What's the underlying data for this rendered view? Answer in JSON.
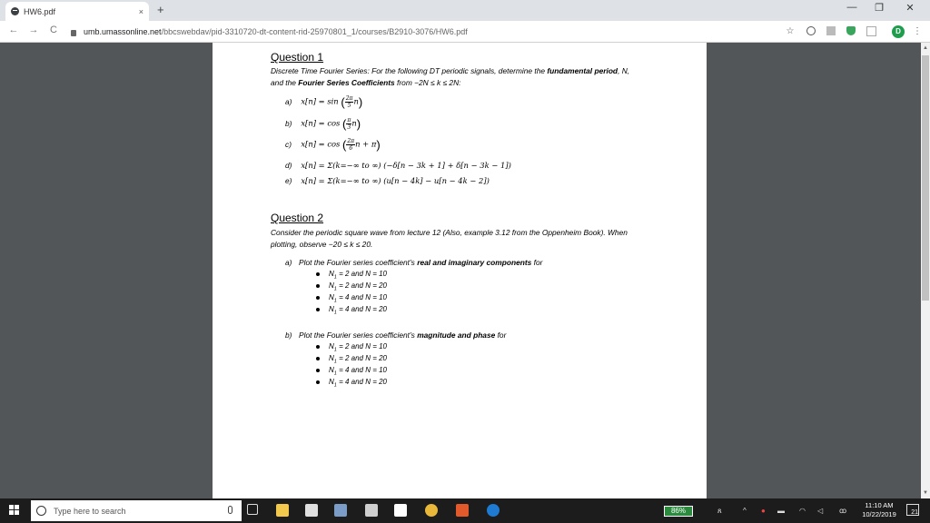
{
  "browser": {
    "tab_title": "HW6.pdf",
    "tab_close": "×",
    "new_tab": "+",
    "url_host": "umb.umassonline.net",
    "url_path": "/bbcswebdav/pid-3310720-dt-content-rid-25970801_1/courses/B2910-3076/HW6.pdf",
    "profile_initial": "D",
    "minimize": "—",
    "maximize": "❐",
    "close": "✕",
    "back": "←",
    "forward": "→",
    "reload": "C",
    "star": "☆"
  },
  "document": {
    "q1": {
      "title": "Question 1",
      "intro_a": "Discrete Time Fourier Series: For the following DT periodic signals, determine the ",
      "intro_bold1": "fundamental period",
      "intro_b": ", N,",
      "intro_c": "and the ",
      "intro_bold2": "Fourier Series Coefficients",
      "intro_d": " from −2N ≤ k ≤ 2N:",
      "items": [
        {
          "label": "a)",
          "pre": "x[n] = sin ",
          "num": "2π",
          "den": "5",
          "post": "n"
        },
        {
          "label": "b)",
          "pre": "x[n] = cos ",
          "num": "π",
          "den": "3",
          "post": "n"
        },
        {
          "label": "c)",
          "pre": "x[n] = cos ",
          "num": "2π",
          "den": "6",
          "post": "n + π"
        },
        {
          "label": "d)",
          "text": "x[n] = Σ(k=−∞ to ∞) (−δ[n − 3k + 1] + δ[n − 3k − 1])"
        },
        {
          "label": "e)",
          "text": "x[n] = Σ(k=−∞ to ∞) (u[n − 4k] − u[n − 4k − 2])"
        }
      ]
    },
    "q2": {
      "title": "Question 2",
      "intro_a": "Consider the periodic square wave from lecture 12 (Also, example 3.12 from the Oppenheim Book). When",
      "intro_b": "plotting, observe −20 ≤ k ≤ 20.",
      "part_a": {
        "label": "a)",
        "pre": "Plot the Fourier series coefficient’s ",
        "bold": "real and imaginary components",
        "post": " for"
      },
      "part_b": {
        "label": "b)",
        "pre": "Plot the Fourier series coefficient’s ",
        "bold": "magnitude and phase",
        "post": " for"
      },
      "bullets": [
        {
          "n1": "2",
          "n": "10"
        },
        {
          "n1": "2",
          "n": "20"
        },
        {
          "n1": "4",
          "n": "10"
        },
        {
          "n1": "4",
          "n": "20"
        }
      ],
      "bullet_sym_n1": "N",
      "bullet_sub": "1",
      "bullet_eq": " = ",
      "bullet_and": " and N = "
    }
  },
  "taskbar": {
    "search_placeholder": "Type here to search",
    "battery": "86%",
    "time": "11:10 AM",
    "date": "10/22/2019",
    "notifications": "21"
  },
  "colors": {
    "viewer_bg": "#525659",
    "taskbar_bg": "#1c1c1c",
    "profile": "#1e9e4c"
  }
}
